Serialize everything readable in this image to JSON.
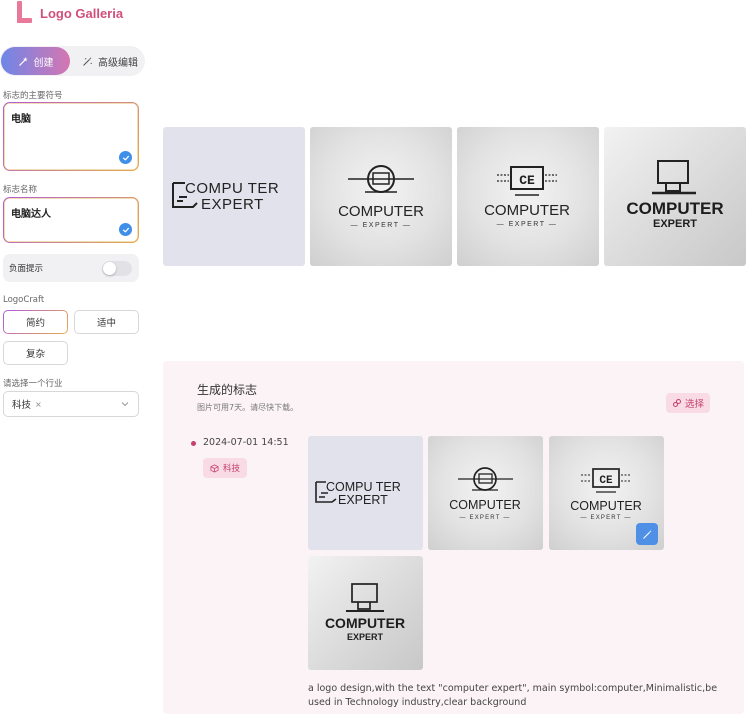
{
  "app": {
    "name": "Logo Galleria"
  },
  "mode": {
    "create_label": "创建",
    "advanced_label": "高级编辑"
  },
  "form": {
    "symbol_label": "标志的主要符号",
    "symbol_value": "电脑",
    "name_label": "标志名称",
    "name_value": "电脑达人",
    "negative_prompt_label": "负面提示",
    "negative_prompt_enabled": false,
    "style_section_label": "LogoCraft",
    "style_options": [
      "简约",
      "适中",
      "复杂"
    ],
    "style_selected": "简约",
    "industry_label": "请选择一个行业",
    "industry_value": "科技",
    "industry_remove": "×"
  },
  "previews": [
    {
      "line1": "COMPU TER",
      "line2": "EXPERT",
      "icon": "computer-outline-icon"
    },
    {
      "line1": "COMPUTER",
      "line2": "— EXPERT —",
      "icon": "monitor-circle-icon"
    },
    {
      "line1": "COMPUTER",
      "line2": "— EXPERT —",
      "icon": "ce-monitor-icon"
    },
    {
      "line1": "COMPUTER",
      "line2": "EXPERT",
      "icon": "monitor-3d-icon"
    }
  ],
  "generated": {
    "title": "生成的标志",
    "subtitle": "图片可用7天。请尽快下载。",
    "select_label": "选择",
    "timestamp": "2024-07-01 14:51",
    "tag": "科技",
    "prompt": "a logo design,with the text \"computer expert\", main symbol:computer,Minimalistic,be used in Technology industry,clear background"
  },
  "colors": {
    "accent": "#c6416f",
    "brand": "#d0507a",
    "blue": "#3f8eea",
    "panel_bg": "#fcf3f6"
  }
}
